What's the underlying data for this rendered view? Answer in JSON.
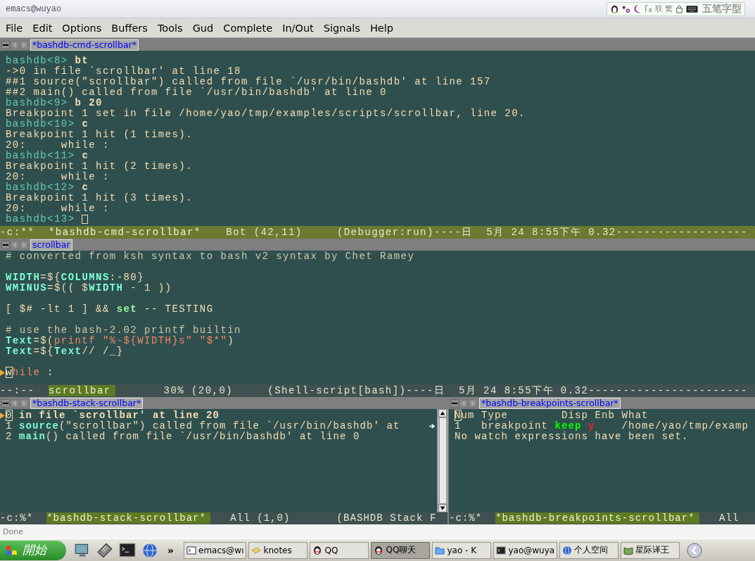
{
  "window": {
    "title": "emacs@wuyao"
  },
  "input_method": {
    "labels": [
      "联",
      "繁"
    ],
    "name": "五笔字型"
  },
  "menu": [
    "File",
    "Edit",
    "Options",
    "Buffers",
    "Tools",
    "Gud",
    "Complete",
    "In/Out",
    "Signals",
    "Help"
  ],
  "top_panes": [
    {
      "header": "*bashdb-cmd-scrollbar*",
      "lines": [
        {
          "kind": "text",
          "segments": [
            {
              "kind": "prompt",
              "text": "bashdb<8> "
            },
            {
              "kind": "command",
              "text": "bt"
            }
          ]
        },
        {
          "kind": "text",
          "segments": [
            {
              "kind": "plain",
              "text": "->0 in file `scrollbar' at line 18"
            }
          ]
        },
        {
          "kind": "text",
          "segments": [
            {
              "kind": "plain",
              "text": "##1 source(\"scrollbar\") called from file `/usr/bin/bashdb' at line 157"
            }
          ]
        },
        {
          "kind": "text",
          "segments": [
            {
              "kind": "plain",
              "text": "##2 main() called from file `/usr/bin/bashdb' at line 0"
            }
          ]
        },
        {
          "kind": "text",
          "segments": [
            {
              "kind": "prompt",
              "text": "bashdb<9> "
            },
            {
              "kind": "command",
              "text": "b 20"
            }
          ]
        },
        {
          "kind": "text",
          "segments": [
            {
              "kind": "plain",
              "text": "Breakpoint 1 set in file /home/yao/tmp/examples/scripts/scrollbar, line 20."
            }
          ]
        },
        {
          "kind": "text",
          "segments": [
            {
              "kind": "prompt",
              "text": "bashdb<10> "
            },
            {
              "kind": "command",
              "text": "c"
            }
          ]
        },
        {
          "kind": "text",
          "segments": [
            {
              "kind": "plain",
              "text": "Breakpoint 1 hit (1 times)."
            }
          ]
        },
        {
          "kind": "text",
          "segments": [
            {
              "kind": "plain",
              "text": "20:     while :"
            }
          ]
        },
        {
          "kind": "text",
          "segments": [
            {
              "kind": "prompt",
              "text": "bashdb<11> "
            },
            {
              "kind": "command",
              "text": "c"
            }
          ]
        },
        {
          "kind": "text",
          "segments": [
            {
              "kind": "plain",
              "text": "Breakpoint 1 hit (2 times)."
            }
          ]
        },
        {
          "kind": "text",
          "segments": [
            {
              "kind": "plain",
              "text": "20:     while :"
            }
          ]
        },
        {
          "kind": "text",
          "segments": [
            {
              "kind": "prompt",
              "text": "bashdb<12> "
            },
            {
              "kind": "command",
              "text": "c"
            }
          ]
        },
        {
          "kind": "text",
          "segments": [
            {
              "kind": "plain",
              "text": "Breakpoint 1 hit (3 times)."
            }
          ]
        },
        {
          "kind": "text",
          "segments": [
            {
              "kind": "plain",
              "text": "20:     while :"
            }
          ]
        },
        {
          "kind": "cursor_end",
          "segments": [
            {
              "kind": "prompt",
              "text": "bashdb<13> "
            }
          ]
        }
      ],
      "mode_line": {
        "active": true,
        "before": "-c:**  ",
        "buffer": "*bashdb-cmd-scrollbar*",
        "after": "   Bot (42,11)     (Debugger:run)----日  5月 24 8:55下午 0.32-------------------"
      }
    },
    {
      "header": "scrollbar",
      "lines": [
        {
          "kind": "text",
          "segments": [
            {
              "kind": "comment",
              "text": "# converted from ksh syntax to bash v2 syntax by Chet Ramey"
            }
          ]
        },
        {
          "kind": "blank"
        },
        {
          "kind": "text",
          "segments": [
            {
              "kind": "variable",
              "text": "WIDTH"
            },
            {
              "kind": "plain",
              "text": "=${"
            },
            {
              "kind": "variable",
              "text": "COLUMNS"
            },
            {
              "kind": "plain",
              "text": ":-80}"
            }
          ]
        },
        {
          "kind": "text",
          "segments": [
            {
              "kind": "variable",
              "text": "WMINUS"
            },
            {
              "kind": "plain",
              "text": "=$(( $"
            },
            {
              "kind": "variable",
              "text": "WIDTH"
            },
            {
              "kind": "plain",
              "text": " - 1 ))"
            }
          ]
        },
        {
          "kind": "blank"
        },
        {
          "kind": "text",
          "segments": [
            {
              "kind": "plain",
              "text": "[ $# -lt 1 ] && "
            },
            {
              "kind": "builtin",
              "text": "set"
            },
            {
              "kind": "plain",
              "text": " -- TESTING"
            }
          ]
        },
        {
          "kind": "blank"
        },
        {
          "kind": "text",
          "segments": [
            {
              "kind": "comment",
              "text": "# use the bash-2.02 printf builtin"
            }
          ]
        },
        {
          "kind": "text",
          "segments": [
            {
              "kind": "variable",
              "text": "Text"
            },
            {
              "kind": "plain",
              "text": "=$("
            },
            {
              "kind": "string",
              "text": "printf \"%-${WIDTH}s\" \"$*\""
            },
            {
              "kind": "plain",
              "text": ")"
            }
          ]
        },
        {
          "kind": "text",
          "segments": [
            {
              "kind": "variable",
              "text": "Text"
            },
            {
              "kind": "plain",
              "text": "=${"
            },
            {
              "kind": "variable",
              "text": "Text"
            },
            {
              "kind": "plain",
              "text": "// /_}"
            }
          ]
        },
        {
          "kind": "blank"
        },
        {
          "kind": "current",
          "segments": [
            {
              "kind": "cursor",
              "text": "w"
            },
            {
              "kind": "keyword",
              "text": "hile"
            },
            {
              "kind": "plain",
              "text": " :"
            }
          ]
        }
      ],
      "mode_line": {
        "active": false,
        "before": "--:--  ",
        "buffer": "scrollbar",
        "after": "       30% (20,0)     (Shell-script[bash])----日  5月 24 8:55下午 0.32-----------------------"
      }
    }
  ],
  "bottom_panes": [
    {
      "header": "*bashdb-stack-scrollbar*",
      "scrollbar": true,
      "lines": [
        {
          "kind": "current",
          "segments": [
            {
              "kind": "cursor",
              "text": "0"
            },
            {
              "kind": "command",
              "text": " in file `scrollbar' at line 20"
            }
          ]
        },
        {
          "kind": "wrapped",
          "segments": [
            {
              "kind": "plain",
              "text": "1 "
            },
            {
              "kind": "variable",
              "text": "source"
            },
            {
              "kind": "plain",
              "text": "(\"scrollbar\") called from file `/usr/bin/bashdb' at"
            }
          ]
        },
        {
          "kind": "text",
          "segments": [
            {
              "kind": "plain",
              "text": "2 "
            },
            {
              "kind": "variable",
              "text": "main"
            },
            {
              "kind": "plain",
              "text": "() called from file `/usr/bin/bashdb' at line 0"
            }
          ]
        }
      ],
      "mode_line": {
        "active": false,
        "before": "-c:%*  ",
        "buffer": "*bashdb-stack-scrollbar*",
        "after": "   All (1,0)       (BASHDB Stack F"
      }
    },
    {
      "header": "*bashdb-breakpoints-scrollbar*",
      "scrollbar": false,
      "lines": [
        {
          "kind": "text",
          "segments": [
            {
              "kind": "cursor",
              "text": "N"
            },
            {
              "kind": "plain",
              "text": "um Type        Disp Enb What"
            }
          ]
        },
        {
          "kind": "text",
          "segments": [
            {
              "kind": "plain",
              "text": "1   breakpoint "
            },
            {
              "kind": "enabled",
              "text": "keep "
            },
            {
              "kind": "flag",
              "text": "y"
            },
            {
              "kind": "plain",
              "text": "    /home/yao/tmp/examp"
            }
          ]
        },
        {
          "kind": "text",
          "segments": [
            {
              "kind": "plain",
              "text": "No watch expressions have been set."
            }
          ]
        }
      ],
      "mode_line": {
        "active": false,
        "before": "-c:%*  ",
        "buffer": "*bashdb-breakpoints-scrollbar*",
        "after": "   All"
      }
    }
  ],
  "echo_area": "Done",
  "taskbar": {
    "start": "開始",
    "more": "»",
    "tasks": [
      {
        "label": "emacs@wı",
        "selected": false
      },
      {
        "label": "knotes",
        "selected": false
      },
      {
        "label": "QQ",
        "selected": false
      },
      {
        "label": "QQ聊天",
        "selected": true
      },
      {
        "label": "yao - K",
        "selected": false
      },
      {
        "label": "yao@wuya",
        "selected": false
      },
      {
        "label": "个人空间",
        "selected": false
      },
      {
        "label": "星际译王",
        "selected": false
      }
    ]
  }
}
